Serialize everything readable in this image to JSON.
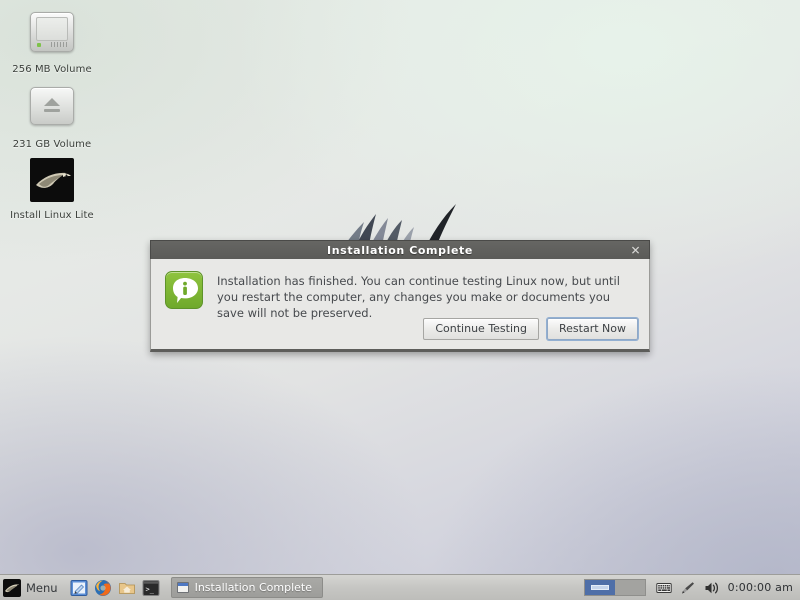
{
  "desktop": {
    "icons": [
      {
        "name": "256 MB Volume",
        "type": "hard-drive-volume-icon"
      },
      {
        "name": "231 GB Volume",
        "type": "removable-volume-icon"
      },
      {
        "name": "Install Linux Lite",
        "type": "installer-icon"
      }
    ]
  },
  "dialog": {
    "title": "Installation Complete",
    "close_label": "✕",
    "icon": "info-icon",
    "message": "Installation has finished.  You can continue testing Linux now, but until you restart the computer, any changes you make or documents you save will not be preserved.",
    "buttons": [
      {
        "label": "Continue Testing",
        "default": false
      },
      {
        "label": "Restart Now",
        "default": true
      }
    ]
  },
  "panel": {
    "menu_label": "Menu",
    "launchers": [
      {
        "label": "Text Editor",
        "icon": "text-editor-icon"
      },
      {
        "label": "Firefox Web Browser",
        "icon": "firefox-icon"
      },
      {
        "label": "File Manager",
        "icon": "folder-home-icon"
      },
      {
        "label": "Terminal",
        "icon": "terminal-icon"
      }
    ],
    "tasks": [
      {
        "label": "Installation Complete",
        "active": true
      }
    ],
    "workspaces": [
      {
        "index": 1,
        "active": true,
        "has_window": true
      },
      {
        "index": 2,
        "active": false,
        "has_window": false
      }
    ],
    "tray": [
      {
        "label": "Keyboard Layout",
        "icon": "keyboard-icon"
      },
      {
        "label": "Updates",
        "icon": "brush-icon"
      },
      {
        "label": "Volume",
        "icon": "speaker-icon"
      }
    ],
    "clock": "0:00:00 am"
  },
  "colors": {
    "accent_green": "#7fb733",
    "titlebar": "#5f5f5c",
    "panel": "#c6c6c3",
    "workspace_active": "#4f6fa8",
    "focus_blue": "#93b0d2"
  }
}
